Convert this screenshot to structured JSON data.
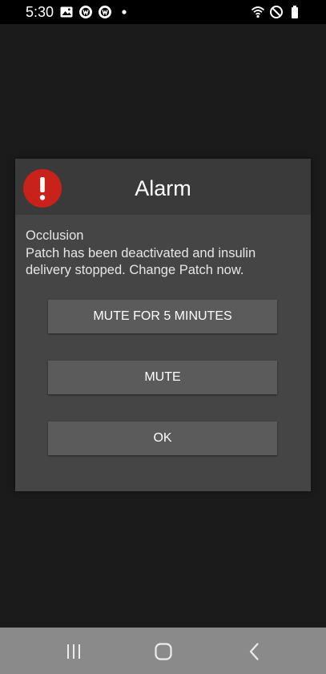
{
  "status_bar": {
    "time": "5:30",
    "left_icons": [
      "gallery-icon",
      "app-notification-icon",
      "app-notification-icon",
      "more-notifications-dot-icon"
    ],
    "right_icons": [
      "wifi-icon",
      "do-not-disturb-icon",
      "battery-icon"
    ]
  },
  "dialog": {
    "title": "Alarm",
    "icon": "alarm-exclamation-icon",
    "icon_color": "#c8221a",
    "message_heading": "Occlusion",
    "message_line_1": "Patch has been deactivated and insulin",
    "message_line_2": "delivery stopped. Change Patch now.",
    "buttons": {
      "mute_5_minutes": "MUTE FOR 5 MINUTES",
      "mute": "MUTE",
      "ok": "OK"
    }
  },
  "nav_bar": {
    "items": [
      "recent-apps-icon",
      "home-icon",
      "back-icon"
    ]
  },
  "colors": {
    "background": "#1b1b1b",
    "dialog": "#454545",
    "dialog_header": "#3a3a3a",
    "button": "#5b5b5b",
    "nav_bar": "#8a8a8a"
  }
}
